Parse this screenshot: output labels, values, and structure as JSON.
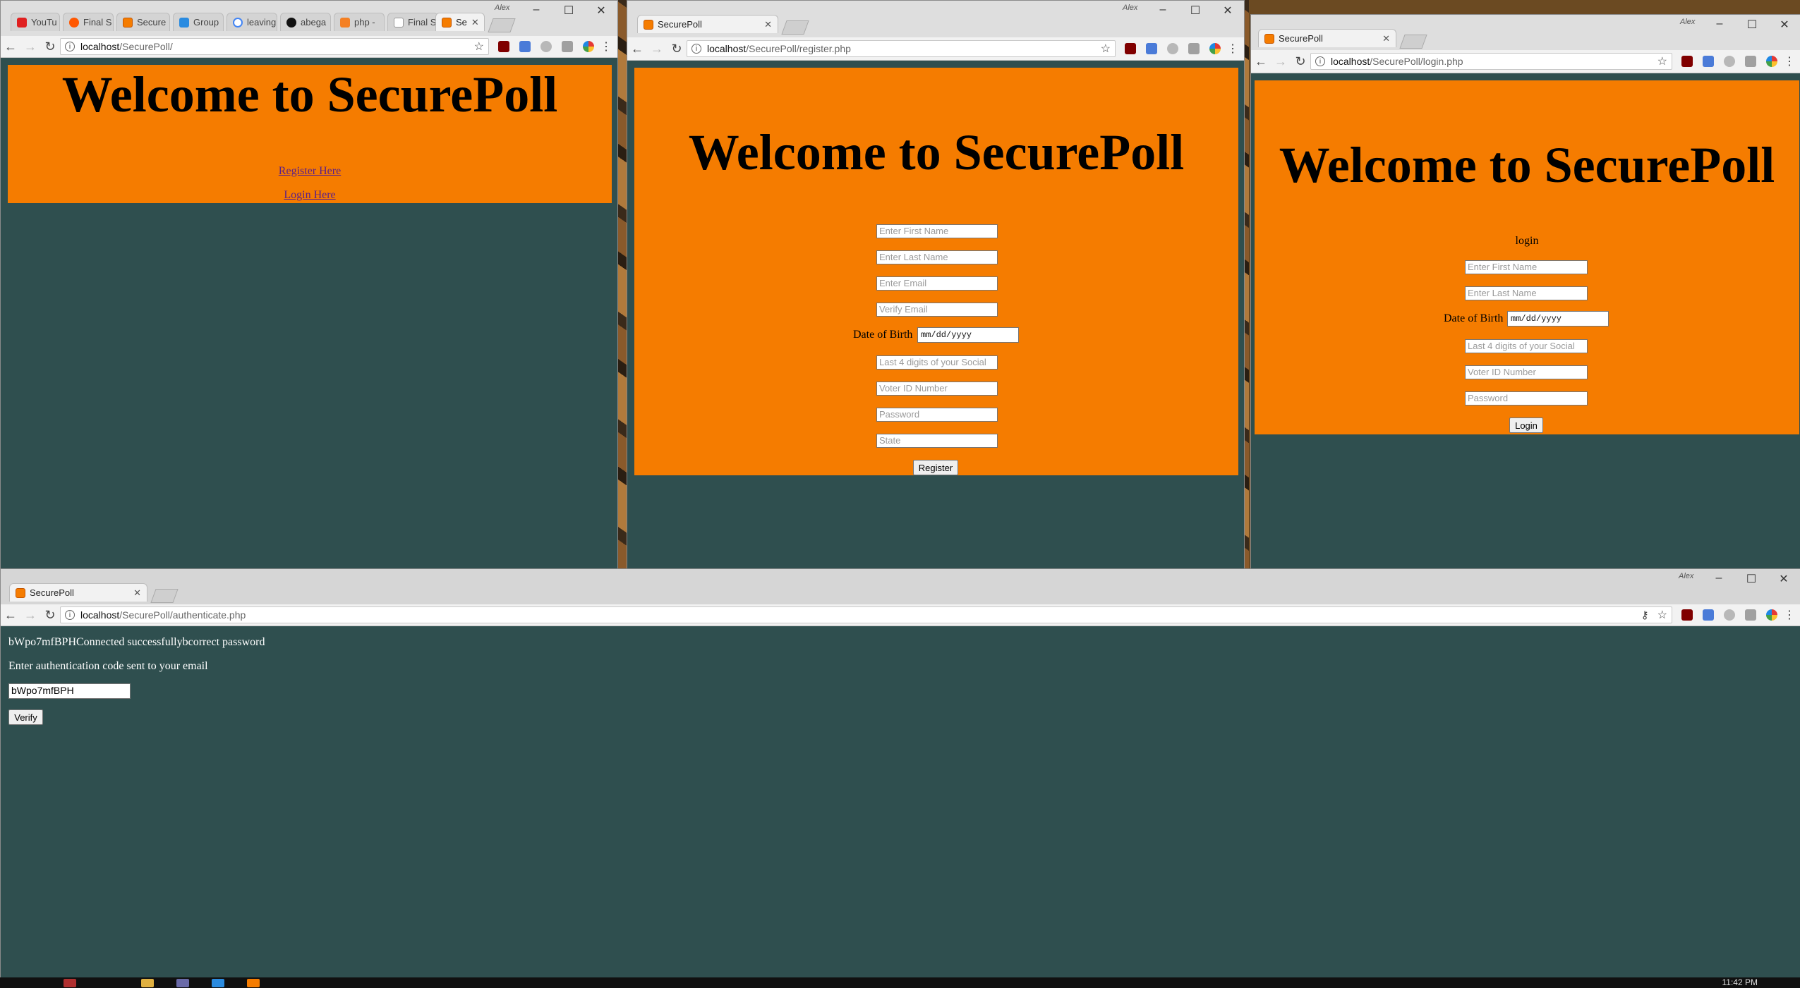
{
  "windows": {
    "home": {
      "tabs": [
        {
          "label": "YouTu",
          "icon": "youtube-icon"
        },
        {
          "label": "Final S",
          "icon": "reddit-icon"
        },
        {
          "label": "Secure",
          "icon": "xampp-icon"
        },
        {
          "label": "Group",
          "icon": "tab-site-icon"
        },
        {
          "label": "leaving",
          "icon": "google-icon"
        },
        {
          "label": "abega",
          "icon": "github-icon"
        },
        {
          "label": "php - ",
          "icon": "stackoverflow-icon"
        },
        {
          "label": "Final S",
          "icon": "wikipedia-icon"
        },
        {
          "label": "Se",
          "icon": "xampp-icon"
        }
      ],
      "user": "Alex",
      "url_host": "localhost",
      "url_path": "/SecurePoll/",
      "heading": "Welcome to SecurePoll",
      "links": [
        "Register Here",
        "Login Here"
      ]
    },
    "register": {
      "tab_title": "SecurePoll",
      "user": "Alex",
      "url_host": "localhost",
      "url_path": "/SecurePoll/register.php",
      "heading": "Welcome to SecurePoll",
      "placeholders": {
        "first_name": "Enter First Name",
        "last_name": "Enter Last Name",
        "email": "Enter Email",
        "verify_email": "Verify Email",
        "ssn": "Last 4 digits of your Social",
        "voter_id": "Voter ID Number",
        "password": "Password",
        "state": "State"
      },
      "dob_label": "Date of Birth",
      "dob_value": "mm/dd/yyyy",
      "submit": "Register"
    },
    "login": {
      "tab_title": "SecurePoll",
      "user": "Alex",
      "url_host": "localhost",
      "url_path": "/SecurePoll/login.php",
      "heading": "Welcome to SecurePoll",
      "subheading": "login",
      "placeholders": {
        "first_name": "Enter First Name",
        "last_name": "Enter Last Name",
        "ssn": "Last 4 digits of your Social",
        "voter_id": "Voter ID Number",
        "password": "Password"
      },
      "dob_label": "Date of Birth",
      "dob_value": "mm/dd/yyyy",
      "submit": "Login"
    },
    "authenticate": {
      "tab_title": "SecurePoll",
      "user": "Alex",
      "url_host": "localhost",
      "url_path": "/SecurePoll/authenticate.php",
      "status_line": "bWpo7mfBPHConnected successfullybcorrect password",
      "prompt": "Enter authentication code sent to your email",
      "code_value": "bWpo7mfBPH",
      "submit": "Verify"
    }
  },
  "taskbar": {
    "clock": "11:42 PM"
  },
  "colors": {
    "page_bg": "#2f4f4f",
    "banner": "#f57c00",
    "link": "#5a1f8a"
  }
}
